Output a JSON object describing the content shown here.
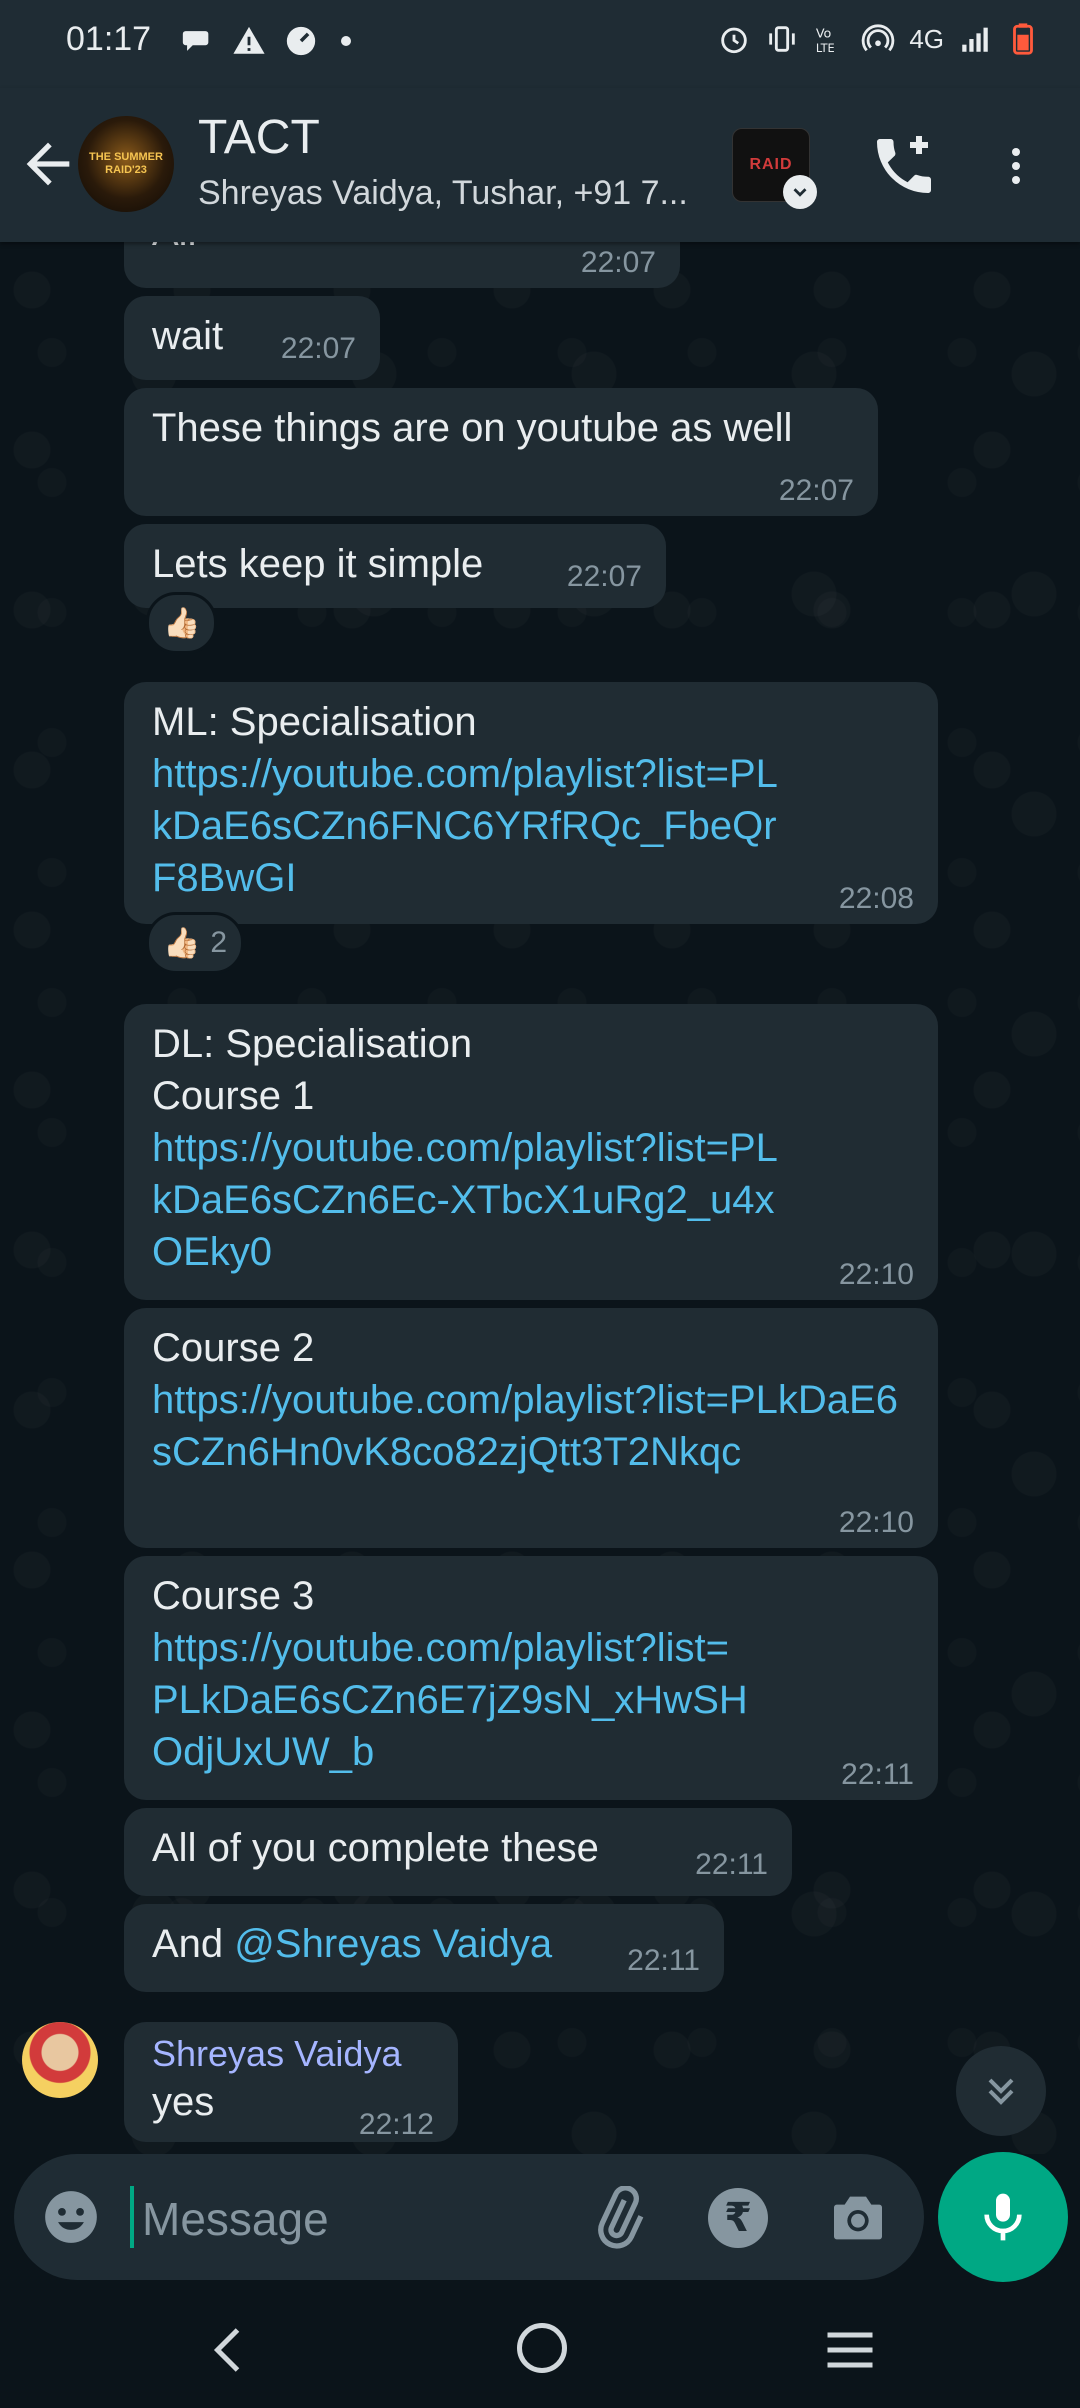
{
  "status_bar": {
    "time": "01:17",
    "network": "4G",
    "left_icons": [
      "chat-bubble-icon",
      "warning-icon",
      "speed-icon",
      "dot-icon"
    ],
    "right_icons": [
      "alarm-icon",
      "vibrate-icon",
      "volte-icon",
      "hotspot-icon",
      "signal-icon",
      "battery-low-icon"
    ]
  },
  "header": {
    "title": "TACT",
    "subtitle": "Shreyas Vaidya, Tushar, +91 7...",
    "avatar_text": "THE SUMMER RAID'23",
    "badge_text": "RAID"
  },
  "messages": [
    {
      "text": "Aii",
      "time": "22:07"
    },
    {
      "text": "wait",
      "time": "22:07"
    },
    {
      "text": "These things are on youtube as well",
      "time": "22:07"
    },
    {
      "text": "Lets keep it simple",
      "time": "22:07",
      "reaction": "👍🏻"
    },
    {
      "text": "ML: Specialisation",
      "link": "https://youtube.com/playlist?list=PLkDaE6sCZn6FNC6YRfRQc_FbeQrF8BwGI",
      "time": "22:08",
      "reaction": "👍🏻",
      "reaction_count": "2"
    },
    {
      "text": "DL: Specialisation\nCourse 1",
      "link": "https://youtube.com/playlist?list=PLkDaE6sCZn6Ec-XTbcX1uRg2_u4xOEky0",
      "time": "22:10"
    },
    {
      "text": "Course 2",
      "link": "https://youtube.com/playlist?list=PLkDaE6sCZn6Hn0vK8co82zjQtt3T2Nkqc",
      "time": "22:10"
    },
    {
      "text": "Course 3",
      "link": "https://youtube.com/playlist?list=PLkDaE6sCZn6E7jZ9sN_xHwSHOdjUxUW_b",
      "time": "22:11"
    },
    {
      "text": "All of you complete these",
      "time": "22:11"
    },
    {
      "text": "And ",
      "mention": "@Shreyas Vaidya",
      "time": "22:11"
    },
    {
      "sender": "Shreyas Vaidya",
      "text": "yes",
      "time": "22:12"
    }
  ],
  "composer": {
    "placeholder": "Message"
  },
  "colors": {
    "background": "#0b141a",
    "bubble": "#202c33",
    "bar": "#1f2c34",
    "link": "#53bdeb",
    "accent": "#00a884",
    "sender_name": "#a5b5ff",
    "timestamp": "#8696a0"
  }
}
